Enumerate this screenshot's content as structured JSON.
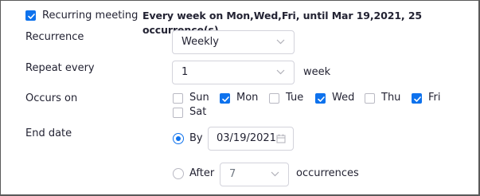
{
  "header": {
    "checkbox_label": "Recurring meeting",
    "summary": "Every week on Mon,Wed,Fri, until Mar 19,2021, 25 occurrence(s)"
  },
  "recurrence": {
    "label": "Recurrence",
    "value": "Weekly"
  },
  "repeat": {
    "label": "Repeat every",
    "value": "1",
    "unit": "week"
  },
  "occurs": {
    "label": "Occurs on",
    "days": [
      {
        "name": "Sun",
        "checked": false
      },
      {
        "name": "Mon",
        "checked": true
      },
      {
        "name": "Tue",
        "checked": false
      },
      {
        "name": "Wed",
        "checked": true
      },
      {
        "name": "Thu",
        "checked": false
      },
      {
        "name": "Fri",
        "checked": true
      },
      {
        "name": "Sat",
        "checked": false
      }
    ]
  },
  "end_date": {
    "label": "End date",
    "by_label": "By",
    "by_date": "03/19/2021",
    "after_label": "After",
    "after_value": "7",
    "after_unit": "occurrences",
    "selected": "by"
  },
  "colors": {
    "accent": "#0e72ed",
    "border": "#d3d3db",
    "text": "#232333"
  },
  "icons": {
    "check": "check-icon",
    "chevron": "chevron-down-icon",
    "calendar": "calendar-icon"
  }
}
